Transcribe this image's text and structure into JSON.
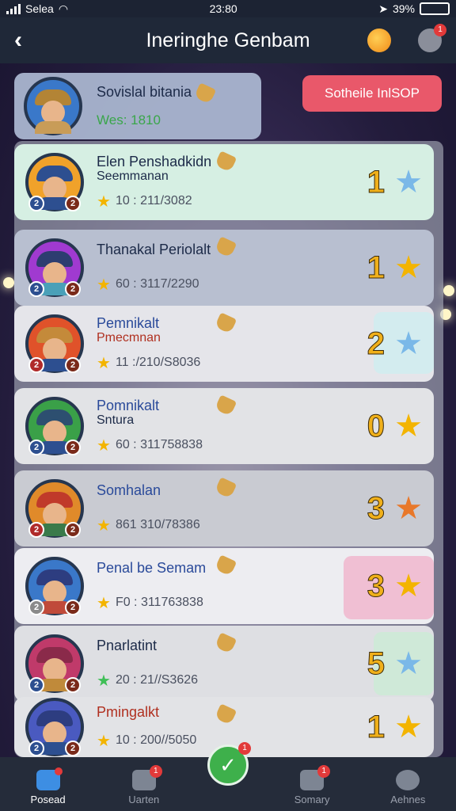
{
  "status": {
    "carrier": "Selea",
    "time": "23:80",
    "battery": "39%"
  },
  "header": {
    "title": "Ineringhe Genbam",
    "back_icon": "chevron-left-icon",
    "coin_icon": "coin-icon",
    "heart_icon": "heart-icon",
    "heart_badge": "1"
  },
  "profile": {
    "name": "Sovislal bitania",
    "sub": "Wes: 1810"
  },
  "shop": {
    "label": "Sotheile InlSOP"
  },
  "rows": [
    {
      "name": "Elen Penshadkidn",
      "name2": "Seemmanan",
      "stat": "10 : 211/3082",
      "rank": "1",
      "star_color": "#7ab8e8",
      "bg": "#d6efe3",
      "box": ""
    },
    {
      "name": "Thanakal Periolalt",
      "name2": "",
      "stat": "60 : 3117/2290",
      "rank": "1",
      "star_color": "#f3b400",
      "bg": "#b8bfd0",
      "box": ""
    },
    {
      "name": "Pemnikalt",
      "name2": "Pmecmnan",
      "stat": "11 :/210/S8036",
      "rank": "2",
      "star_color": "#7ab8e8",
      "bg": "#e5e5ea",
      "box": "#d3ecef"
    },
    {
      "name": "Pomnikalt",
      "name2": "Sntura",
      "stat": "60 : 311758838",
      "rank": "0",
      "star_color": "#f3b400",
      "bg": "#e2e3e6",
      "box": ""
    },
    {
      "name": "Somhalan",
      "name2": "",
      "stat": "861 310/78386",
      "rank": "3",
      "star_color": "#e8782a",
      "bg": "#c9cbd2",
      "box": ""
    },
    {
      "name": "Penal be Semam",
      "name2": "",
      "stat": "F0 : 311763838",
      "rank": "3",
      "star_color": "#f3b400",
      "bg": "#ededf1",
      "box": "#f0bfd3"
    },
    {
      "name": "Pnarlatint",
      "name2": "",
      "stat": "20 : 21//S3626",
      "rank": "5",
      "star_color": "#7ab8e8",
      "bg": "#dedfe3",
      "box": "#cfe9d8"
    },
    {
      "name": "Pmingalkt",
      "name2": "",
      "stat": "10 : 200//5050",
      "rank": "1",
      "star_color": "#f3b400",
      "bg": "#e2e3e6",
      "box": ""
    }
  ],
  "nav": [
    {
      "label": "Posead",
      "active": true,
      "badge": ""
    },
    {
      "label": "Uarten",
      "active": false,
      "badge": "1"
    },
    {
      "label": "Somary",
      "active": false,
      "badge": "1"
    },
    {
      "label": "Aehnes",
      "active": false,
      "badge": ""
    }
  ],
  "center_badge": "1"
}
